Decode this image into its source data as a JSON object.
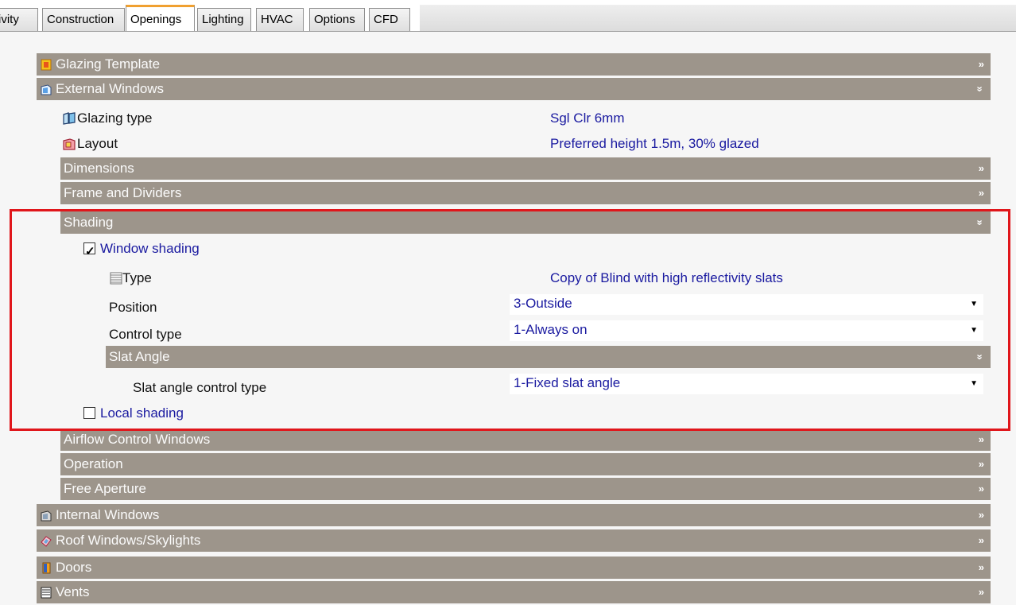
{
  "tabs": [
    {
      "label": "ivity"
    },
    {
      "label": "Construction"
    },
    {
      "label": "Openings"
    },
    {
      "label": "Lighting"
    },
    {
      "label": "HVAC"
    },
    {
      "label": "Options"
    },
    {
      "label": "CFD"
    }
  ],
  "active_tab": "Openings",
  "sections": {
    "glazing_template": "Glazing Template",
    "external_windows": "External Windows",
    "dimensions": "Dimensions",
    "frame_and_dividers": "Frame and Dividers",
    "shading": "Shading",
    "slat_angle": "Slat Angle",
    "airflow_control_windows": "Airflow Control Windows",
    "operation": "Operation",
    "free_aperture": "Free Aperture",
    "internal_windows": "Internal Windows",
    "roof_windows": "Roof Windows/Skylights",
    "doors": "Doors",
    "vents": "Vents"
  },
  "chevrons": {
    "collapsed": "»",
    "expanded": "»"
  },
  "properties": {
    "glazing_type": {
      "label": "Glazing type",
      "value": "Sgl Clr 6mm"
    },
    "layout": {
      "label": "Layout",
      "value": "Preferred height 1.5m, 30% glazed"
    },
    "window_shading": {
      "label": "Window shading",
      "checked": true
    },
    "type": {
      "label": "Type",
      "value": "Copy of Blind with high reflectivity slats"
    },
    "position": {
      "label": "Position",
      "value": "3-Outside"
    },
    "control_type": {
      "label": "Control type",
      "value": "1-Always on"
    },
    "slat_angle_control_type": {
      "label": "Slat angle control type",
      "value": "1-Fixed slat angle"
    },
    "local_shading": {
      "label": "Local shading",
      "checked": false
    }
  },
  "colors": {
    "header_bg": "#9d958b",
    "value_text": "#1a1aa0",
    "highlight_border": "#e0161b",
    "active_tab_accent": "#f0a030"
  }
}
